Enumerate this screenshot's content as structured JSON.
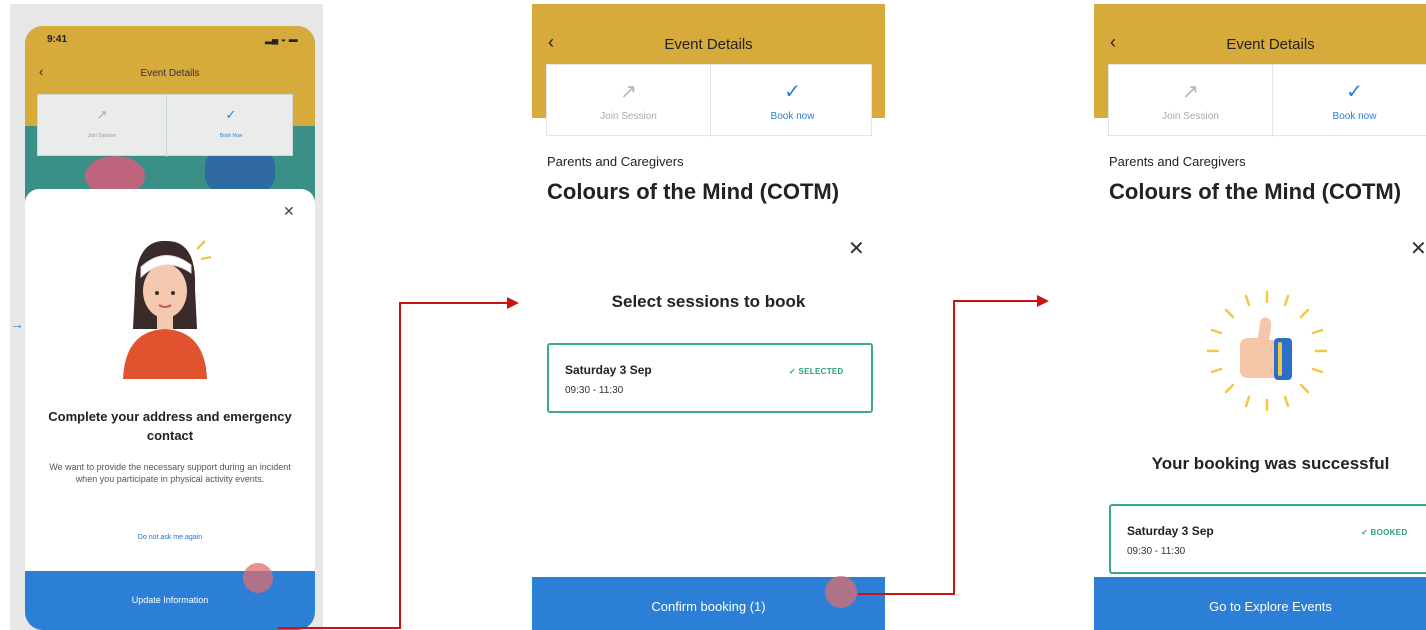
{
  "screen1": {
    "status_time": "9:41",
    "status_icons": "▂▄ ◒ ▬",
    "header_title": "Event Details",
    "back_icon": "chevron-left",
    "actions": [
      {
        "icon": "↗",
        "label": "Join Session"
      },
      {
        "icon": "✓",
        "label": "Book Now"
      }
    ],
    "modal": {
      "title": "Complete your address and emergency contact",
      "body": "We want to provide the necessary support during an incident when you participate in physical activity events.",
      "dismiss_link": "Do not ask me again",
      "primary_button": "Update Information"
    }
  },
  "screen2": {
    "header_title": "Event Details",
    "actions": [
      {
        "icon": "↗",
        "label": "Join Session"
      },
      {
        "icon": "✓",
        "label": "Book now"
      }
    ],
    "category": "Parents and Caregivers",
    "event_title": "Colours of the Mind (COTM)",
    "modal": {
      "title": "Select sessions to book",
      "session": {
        "date": "Saturday 3 Sep",
        "time": "09:30 - 11:30",
        "status": "✓  SELECTED"
      },
      "primary_button": "Confirm booking (1)"
    }
  },
  "screen3": {
    "header_title": "Event Details",
    "actions": [
      {
        "icon": "↗",
        "label": "Join Session"
      },
      {
        "icon": "✓",
        "label": "Book now"
      }
    ],
    "category": "Parents and Caregivers",
    "event_title": "Colours of the Mind (COTM)",
    "modal": {
      "title": "Your booking was successful",
      "session": {
        "date": "Saturday 3 Sep",
        "time": "09:30 - 11:30",
        "status": "✓  BOOKED"
      },
      "primary_button": "Go to Explore Events"
    }
  },
  "colors": {
    "header_gold": "#d6aa3b",
    "primary_blue": "#2b7fd6",
    "success_green": "#3ba88a",
    "connector_red": "#c81414"
  },
  "icons": [
    "back-icon",
    "external-link-icon",
    "check-icon",
    "close-icon",
    "thumbs-up-icon"
  ]
}
